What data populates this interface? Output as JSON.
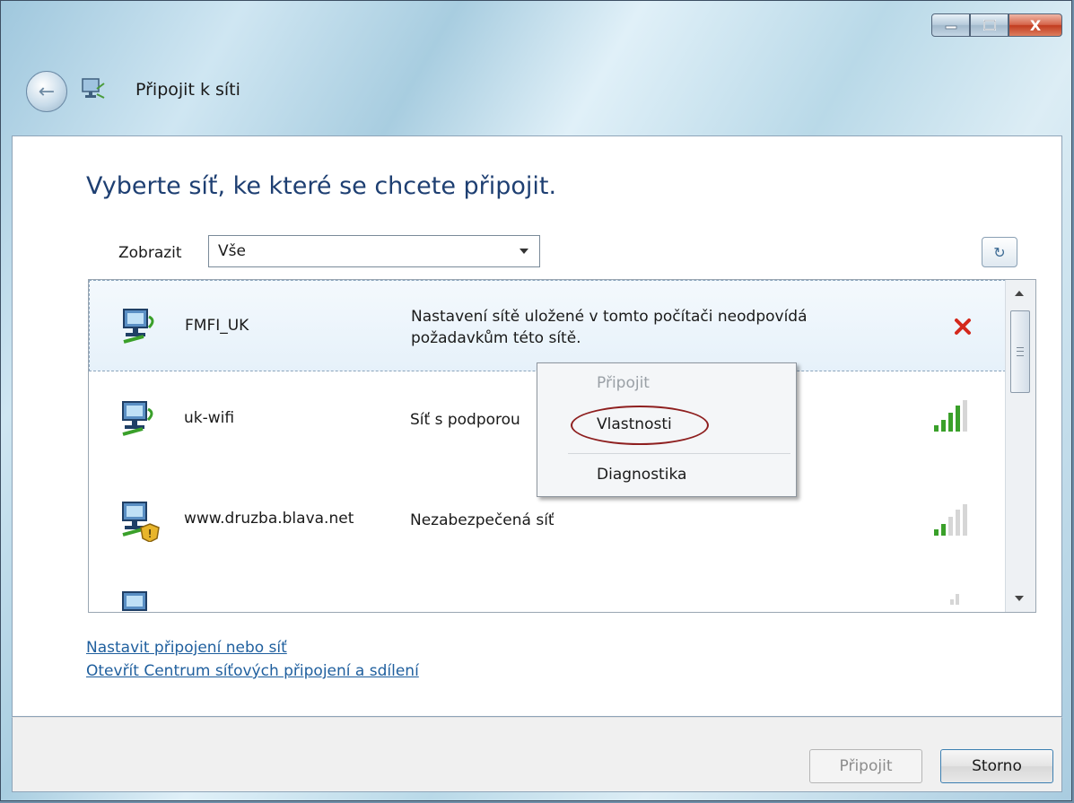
{
  "window": {
    "title": "Připojit k síti",
    "controls": [
      "minimize",
      "maximize",
      "close"
    ],
    "close_glyph": "X",
    "back_glyph": "←"
  },
  "main": {
    "heading": "Vyberte síť, ke které se chcete připojit.",
    "filter_label": "Zobrazit",
    "filter_value": "Vše",
    "refresh_glyph": "↻"
  },
  "networks": [
    {
      "name": "FMFI_UK",
      "desc_line1": "Nastavení sítě uložené v tomto počítači neodpovídá",
      "desc_line2": "požadavkům této sítě.",
      "status": "error-x-icon",
      "selected": true
    },
    {
      "name": "uk-wifi",
      "desc_line1": "Síť s podporou",
      "status": "signal-bars-icon",
      "signal": 4
    },
    {
      "name": "www.druzba.blava.net",
      "desc_line1": "Nezabezpečená síť",
      "status": "signal-bars-icon",
      "signal": 2
    },
    {
      "name": "",
      "desc_line1": "",
      "status": "signal-bars-icon",
      "signal": 1
    }
  ],
  "context_menu": {
    "items": [
      "Připojit",
      "Vlastnosti",
      "Diagnostika"
    ],
    "disabled": [
      "Připojit"
    ],
    "circled": "Vlastnosti"
  },
  "links": {
    "setup": "Nastavit připojení nebo síť",
    "center": "Otevřít Centrum síťových připojení a sdílení"
  },
  "footer": {
    "connect_label": "Připojit",
    "cancel_label": "Storno"
  },
  "colors": {
    "heading": "#1e3f72",
    "link": "#1f5f9e",
    "error_red": "#d4281c",
    "signal_green": "#3aa02a",
    "circle_red": "#8e1f1f"
  }
}
